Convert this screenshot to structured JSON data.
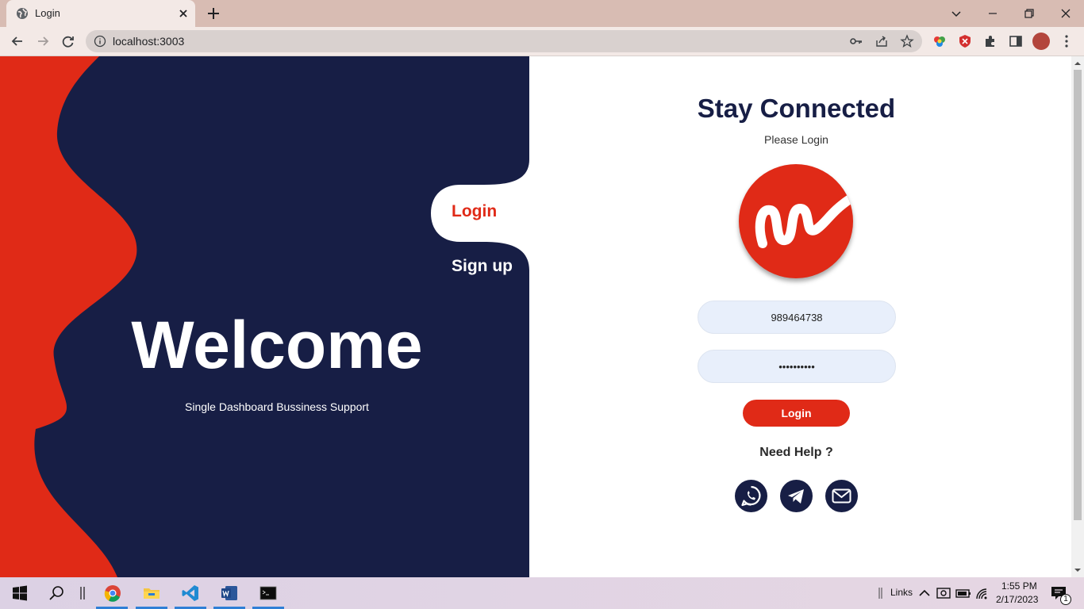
{
  "browser": {
    "tab_title": "Login",
    "url": "localhost:3003"
  },
  "left": {
    "nav_login": "Login",
    "nav_signup": "Sign up",
    "welcome": "Welcome",
    "tagline": "Single Dashboard Bussiness Support"
  },
  "form": {
    "title": "Stay Connected",
    "subtitle": "Please Login",
    "phone_value": "989464738",
    "password_value": "password12",
    "login_label": "Login",
    "help_label": "Need Help ?"
  },
  "taskbar": {
    "links_label": "Links",
    "time": "1:55 PM",
    "date": "2/17/2023",
    "notification_count": "1"
  },
  "colors": {
    "accent": "#e02a17",
    "navy": "#171e45"
  }
}
